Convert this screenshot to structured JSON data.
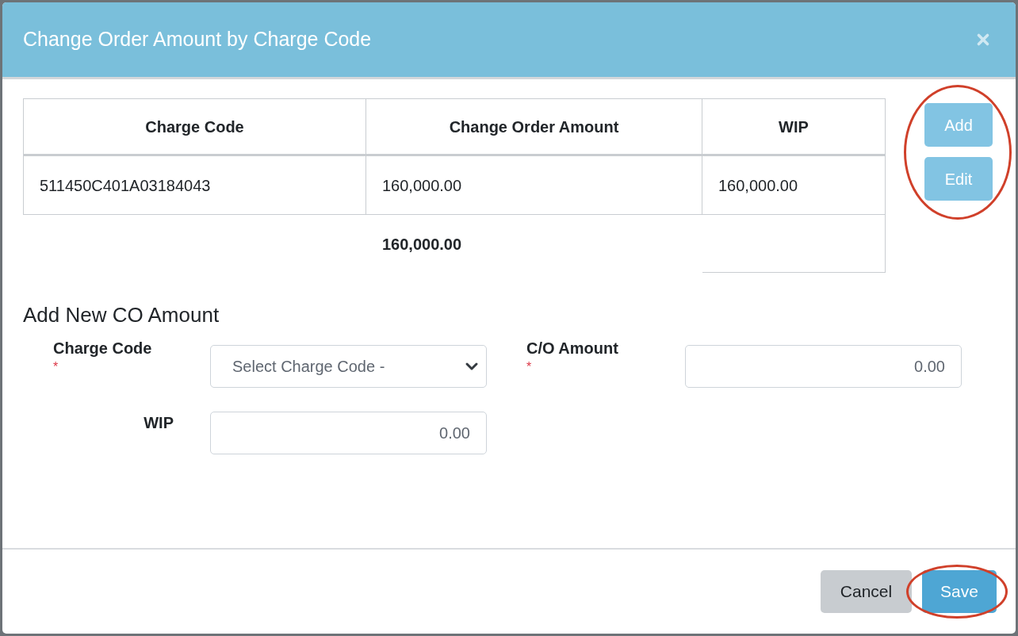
{
  "dialog": {
    "title": "Change Order Amount by Charge Code"
  },
  "table": {
    "columns": [
      "Charge Code",
      "Change Order Amount",
      "WIP"
    ],
    "rows": [
      [
        "511450C401A03184043",
        "160,000.00",
        "160,000.00"
      ]
    ],
    "total": "160,000.00"
  },
  "side_buttons": [
    "Add",
    "Edit"
  ],
  "form": {
    "heading": "Add New CO Amount",
    "charge_code": {
      "label": "Charge Code",
      "required_mark": "*",
      "placeholder": "Select Charge Code -"
    },
    "co_amount": {
      "label": "C/O Amount",
      "required_mark": "*",
      "placeholder": "0.00"
    },
    "wip": {
      "label": "WIP",
      "placeholder": "0.00"
    }
  },
  "footer_buttons": [
    {
      "label": "Cancel",
      "kind": "secondary"
    },
    {
      "label": "Save",
      "kind": "primary"
    }
  ],
  "annotations": [
    {
      "kind": "ellipse"
    },
    {
      "kind": "ellipse"
    }
  ]
}
